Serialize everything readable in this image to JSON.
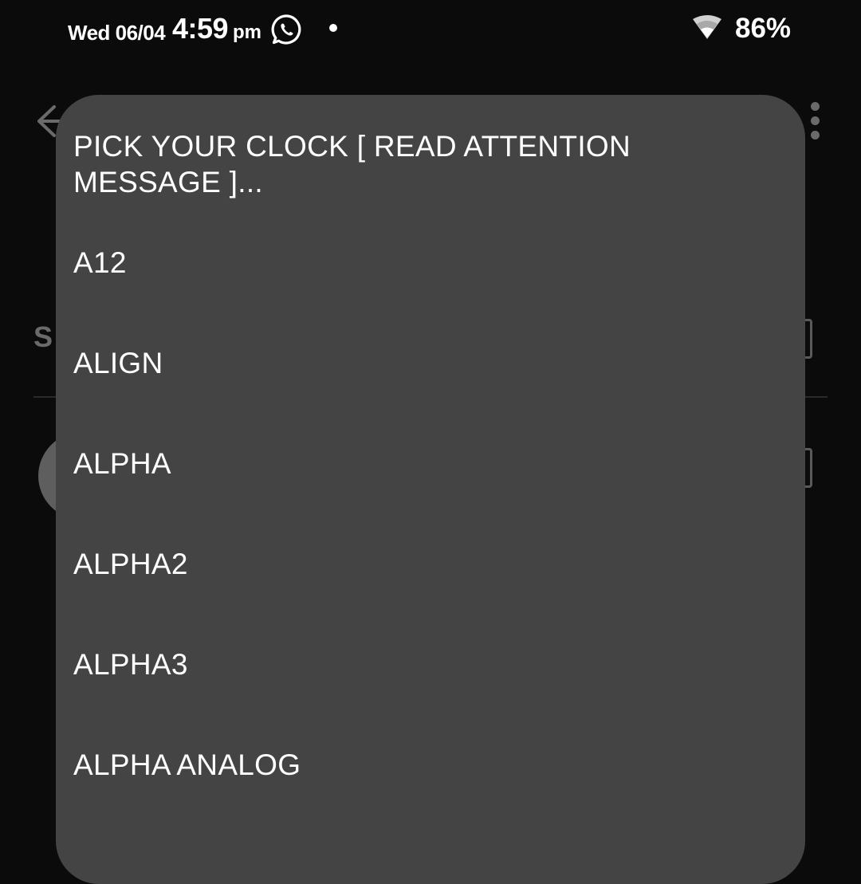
{
  "status_bar": {
    "date": "Wed 06/04",
    "time": "4:59",
    "ampm": "pm",
    "battery": "86%",
    "icons": [
      "whatsapp-icon",
      "notification-dot-icon",
      "wifi-icon"
    ]
  },
  "background": {
    "section_label_partial": "S",
    "icons": [
      "back-arrow-icon",
      "more-vert-icon"
    ]
  },
  "dialog": {
    "title": "PICK YOUR CLOCK [ READ ATTENTION MESSAGE ]...",
    "options": [
      {
        "label": "A12"
      },
      {
        "label": "ALIGN"
      },
      {
        "label": "ALPHA"
      },
      {
        "label": "ALPHA2"
      },
      {
        "label": "ALPHA3"
      },
      {
        "label": "ALPHA ANALOG"
      },
      {
        "label": ""
      }
    ]
  },
  "colors": {
    "dialog_bg": "#444444",
    "screen_bg": "#0b0b0b",
    "text": "#ffffff"
  }
}
